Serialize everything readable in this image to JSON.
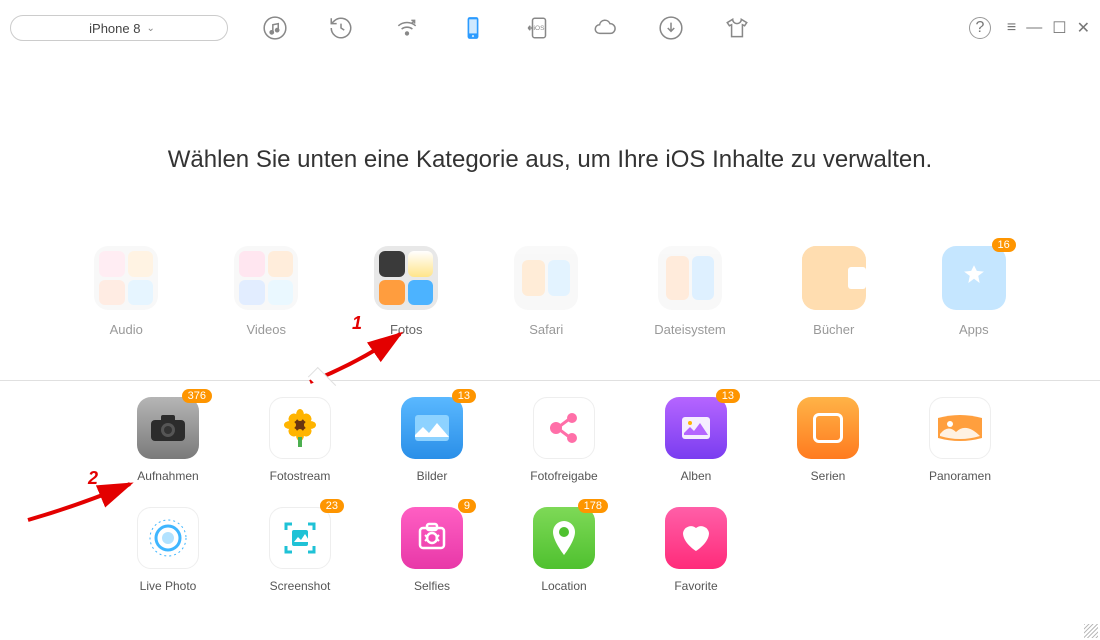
{
  "device": {
    "name": "iPhone 8"
  },
  "toolbar": {
    "icons": [
      "music",
      "history",
      "wifi",
      "phone",
      "ios-transfer",
      "cloud",
      "download",
      "tshirt"
    ],
    "active": "phone"
  },
  "heading": "Wählen Sie unten eine Kategorie aus, um Ihre iOS Inhalte zu verwalten.",
  "categories": [
    {
      "id": "audio",
      "label": "Audio",
      "badge": null,
      "active": false
    },
    {
      "id": "videos",
      "label": "Videos",
      "badge": null,
      "active": false
    },
    {
      "id": "fotos",
      "label": "Fotos",
      "badge": null,
      "active": true
    },
    {
      "id": "safari",
      "label": "Safari",
      "badge": null,
      "active": false
    },
    {
      "id": "dateisystem",
      "label": "Dateisystem",
      "badge": null,
      "active": false
    },
    {
      "id": "buecher",
      "label": "Bücher",
      "badge": null,
      "active": false
    },
    {
      "id": "apps",
      "label": "Apps",
      "badge": "16",
      "active": false
    }
  ],
  "subcategories_row1": [
    {
      "id": "aufnahmen",
      "label": "Aufnahmen",
      "badge": "376",
      "color": "camera"
    },
    {
      "id": "fotostream",
      "label": "Fotostream",
      "badge": null,
      "color": "flower"
    },
    {
      "id": "bilder",
      "label": "Bilder",
      "badge": "13",
      "color": "blue"
    },
    {
      "id": "fotofreigabe",
      "label": "Fotofreigabe",
      "badge": null,
      "color": "pink-share"
    },
    {
      "id": "alben",
      "label": "Alben",
      "badge": "13",
      "color": "purple"
    },
    {
      "id": "serien",
      "label": "Serien",
      "badge": null,
      "color": "orange-sq"
    },
    {
      "id": "panoramen",
      "label": "Panoramen",
      "badge": null,
      "color": "orange-pano"
    }
  ],
  "subcategories_row2": [
    {
      "id": "livephoto",
      "label": "Live Photo",
      "badge": null,
      "color": "live"
    },
    {
      "id": "screenshot",
      "label": "Screenshot",
      "badge": "23",
      "color": "teal"
    },
    {
      "id": "selfies",
      "label": "Selfies",
      "badge": "9",
      "color": "magenta"
    },
    {
      "id": "location",
      "label": "Location",
      "badge": "178",
      "color": "green"
    },
    {
      "id": "favorite",
      "label": "Favorite",
      "badge": null,
      "color": "pink-heart"
    }
  ],
  "annotations": {
    "1": "1",
    "2": "2"
  }
}
